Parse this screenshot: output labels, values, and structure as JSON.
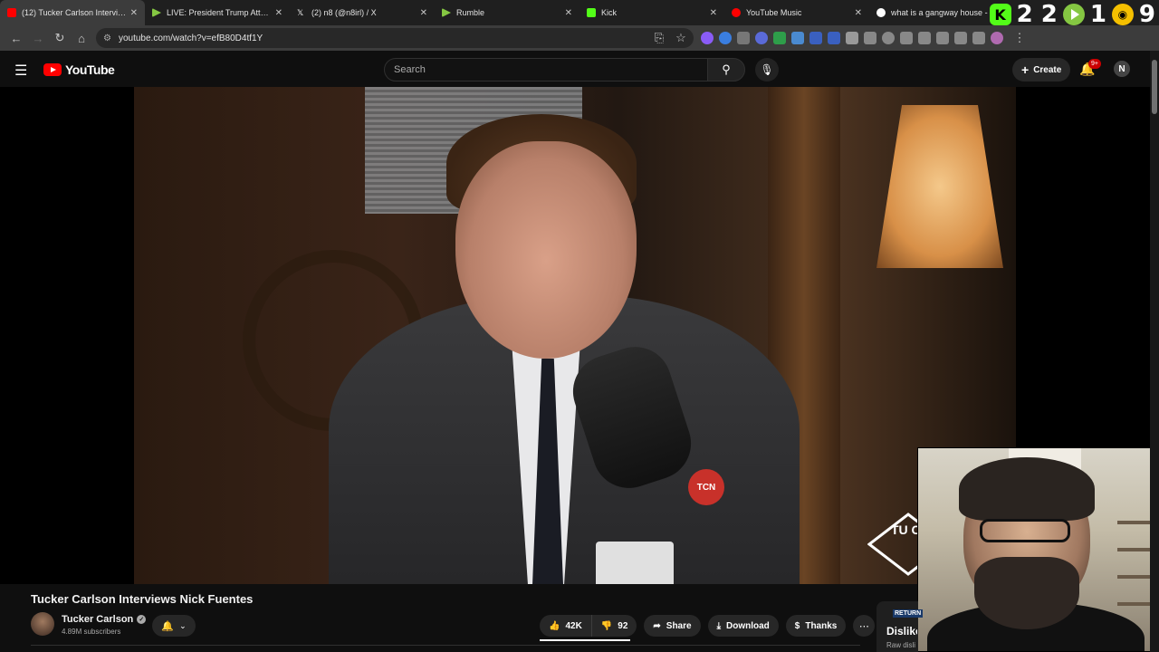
{
  "browser": {
    "tabs": [
      {
        "label": "(12) Tucker Carlson Interviews N",
        "icon": "youtube-icon",
        "color": "#ff0000",
        "active": true
      },
      {
        "label": "LIVE: President Trump Attends a",
        "icon": "rumble-icon",
        "color": "#85c742",
        "active": false
      },
      {
        "label": "(2) n8 (@n8irl) / X",
        "icon": "x-icon",
        "color": "#ffffff",
        "active": false
      },
      {
        "label": "Rumble",
        "icon": "rumble-icon",
        "color": "#85c742",
        "active": false
      },
      {
        "label": "Kick",
        "icon": "kick-icon",
        "color": "#53fc18",
        "active": false
      },
      {
        "label": "YouTube Music",
        "icon": "youtube-music-icon",
        "color": "#ff0000",
        "active": false
      },
      {
        "label": "what is a gangway house - Go",
        "icon": "google-icon",
        "color": "#4285f4",
        "active": false
      }
    ],
    "overlay": {
      "kick_count": "2 2",
      "rumble_count": "1",
      "other_count": "9",
      "kick_letter": "K"
    },
    "url": "youtube.com/watch?v=efB80D4tf1Y"
  },
  "youtube": {
    "logo_text": "YouTube",
    "search_placeholder": "Search",
    "create_label": "Create",
    "notif_badge": "9+",
    "avatar_letter": "N"
  },
  "video": {
    "title": "Tucker Carlson Interviews Nick Fuentes",
    "mic_logo": "TCN",
    "watermark": "TU CA"
  },
  "channel": {
    "name": "Tucker Carlson",
    "subscribers": "4.89M subscribers"
  },
  "actions": {
    "likes": "42K",
    "dislikes": "92",
    "share": "Share",
    "download": "Download",
    "thanks": "Thanks"
  },
  "ryd": {
    "badge": "RETURN",
    "title": "Dislike",
    "sub": "Raw disli"
  },
  "colors": {
    "accent": "#ff0000",
    "background": "#0f0f0f",
    "surface": "#272727"
  }
}
